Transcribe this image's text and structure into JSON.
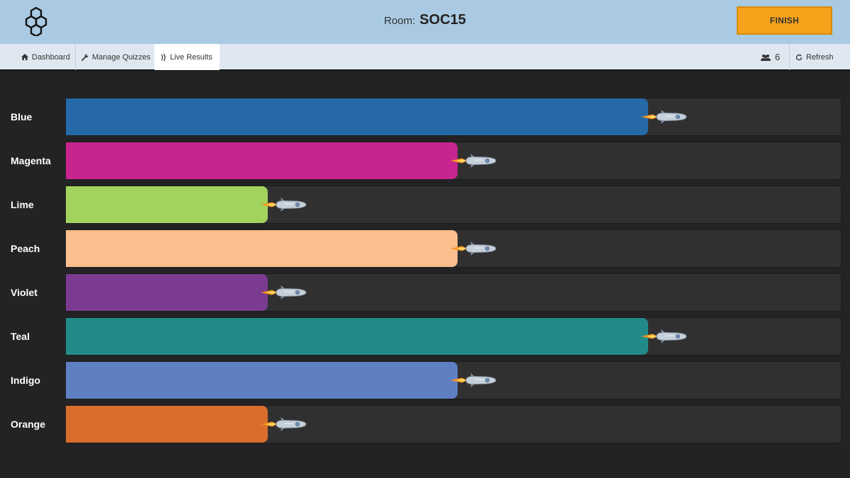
{
  "header": {
    "room_label": "Room:",
    "room_code": "SOC15",
    "finish_label": "FINISH"
  },
  "nav": {
    "items": [
      {
        "label": "Dashboard",
        "icon": "home-icon"
      },
      {
        "label": "Manage Quizzes",
        "icon": "wrench-icon"
      },
      {
        "label": "Live Results",
        "icon": "signal-icon",
        "active": true
      }
    ],
    "user_count": "6",
    "refresh_label": "Refresh"
  },
  "teams": [
    {
      "name": "Blue",
      "color": "#2569a9",
      "progress": 0.75
    },
    {
      "name": "Magenta",
      "color": "#c8248f",
      "progress": 0.505
    },
    {
      "name": "Lime",
      "color": "#a2d35e",
      "progress": 0.26
    },
    {
      "name": "Peach",
      "color": "#fbbe8d",
      "progress": 0.505
    },
    {
      "name": "Violet",
      "color": "#7a3b91",
      "progress": 0.26
    },
    {
      "name": "Teal",
      "color": "#228b8a",
      "progress": 0.75
    },
    {
      "name": "Indigo",
      "color": "#5f7fc3",
      "progress": 0.505
    },
    {
      "name": "Orange",
      "color": "#d96d2e",
      "progress": 0.26
    }
  ]
}
